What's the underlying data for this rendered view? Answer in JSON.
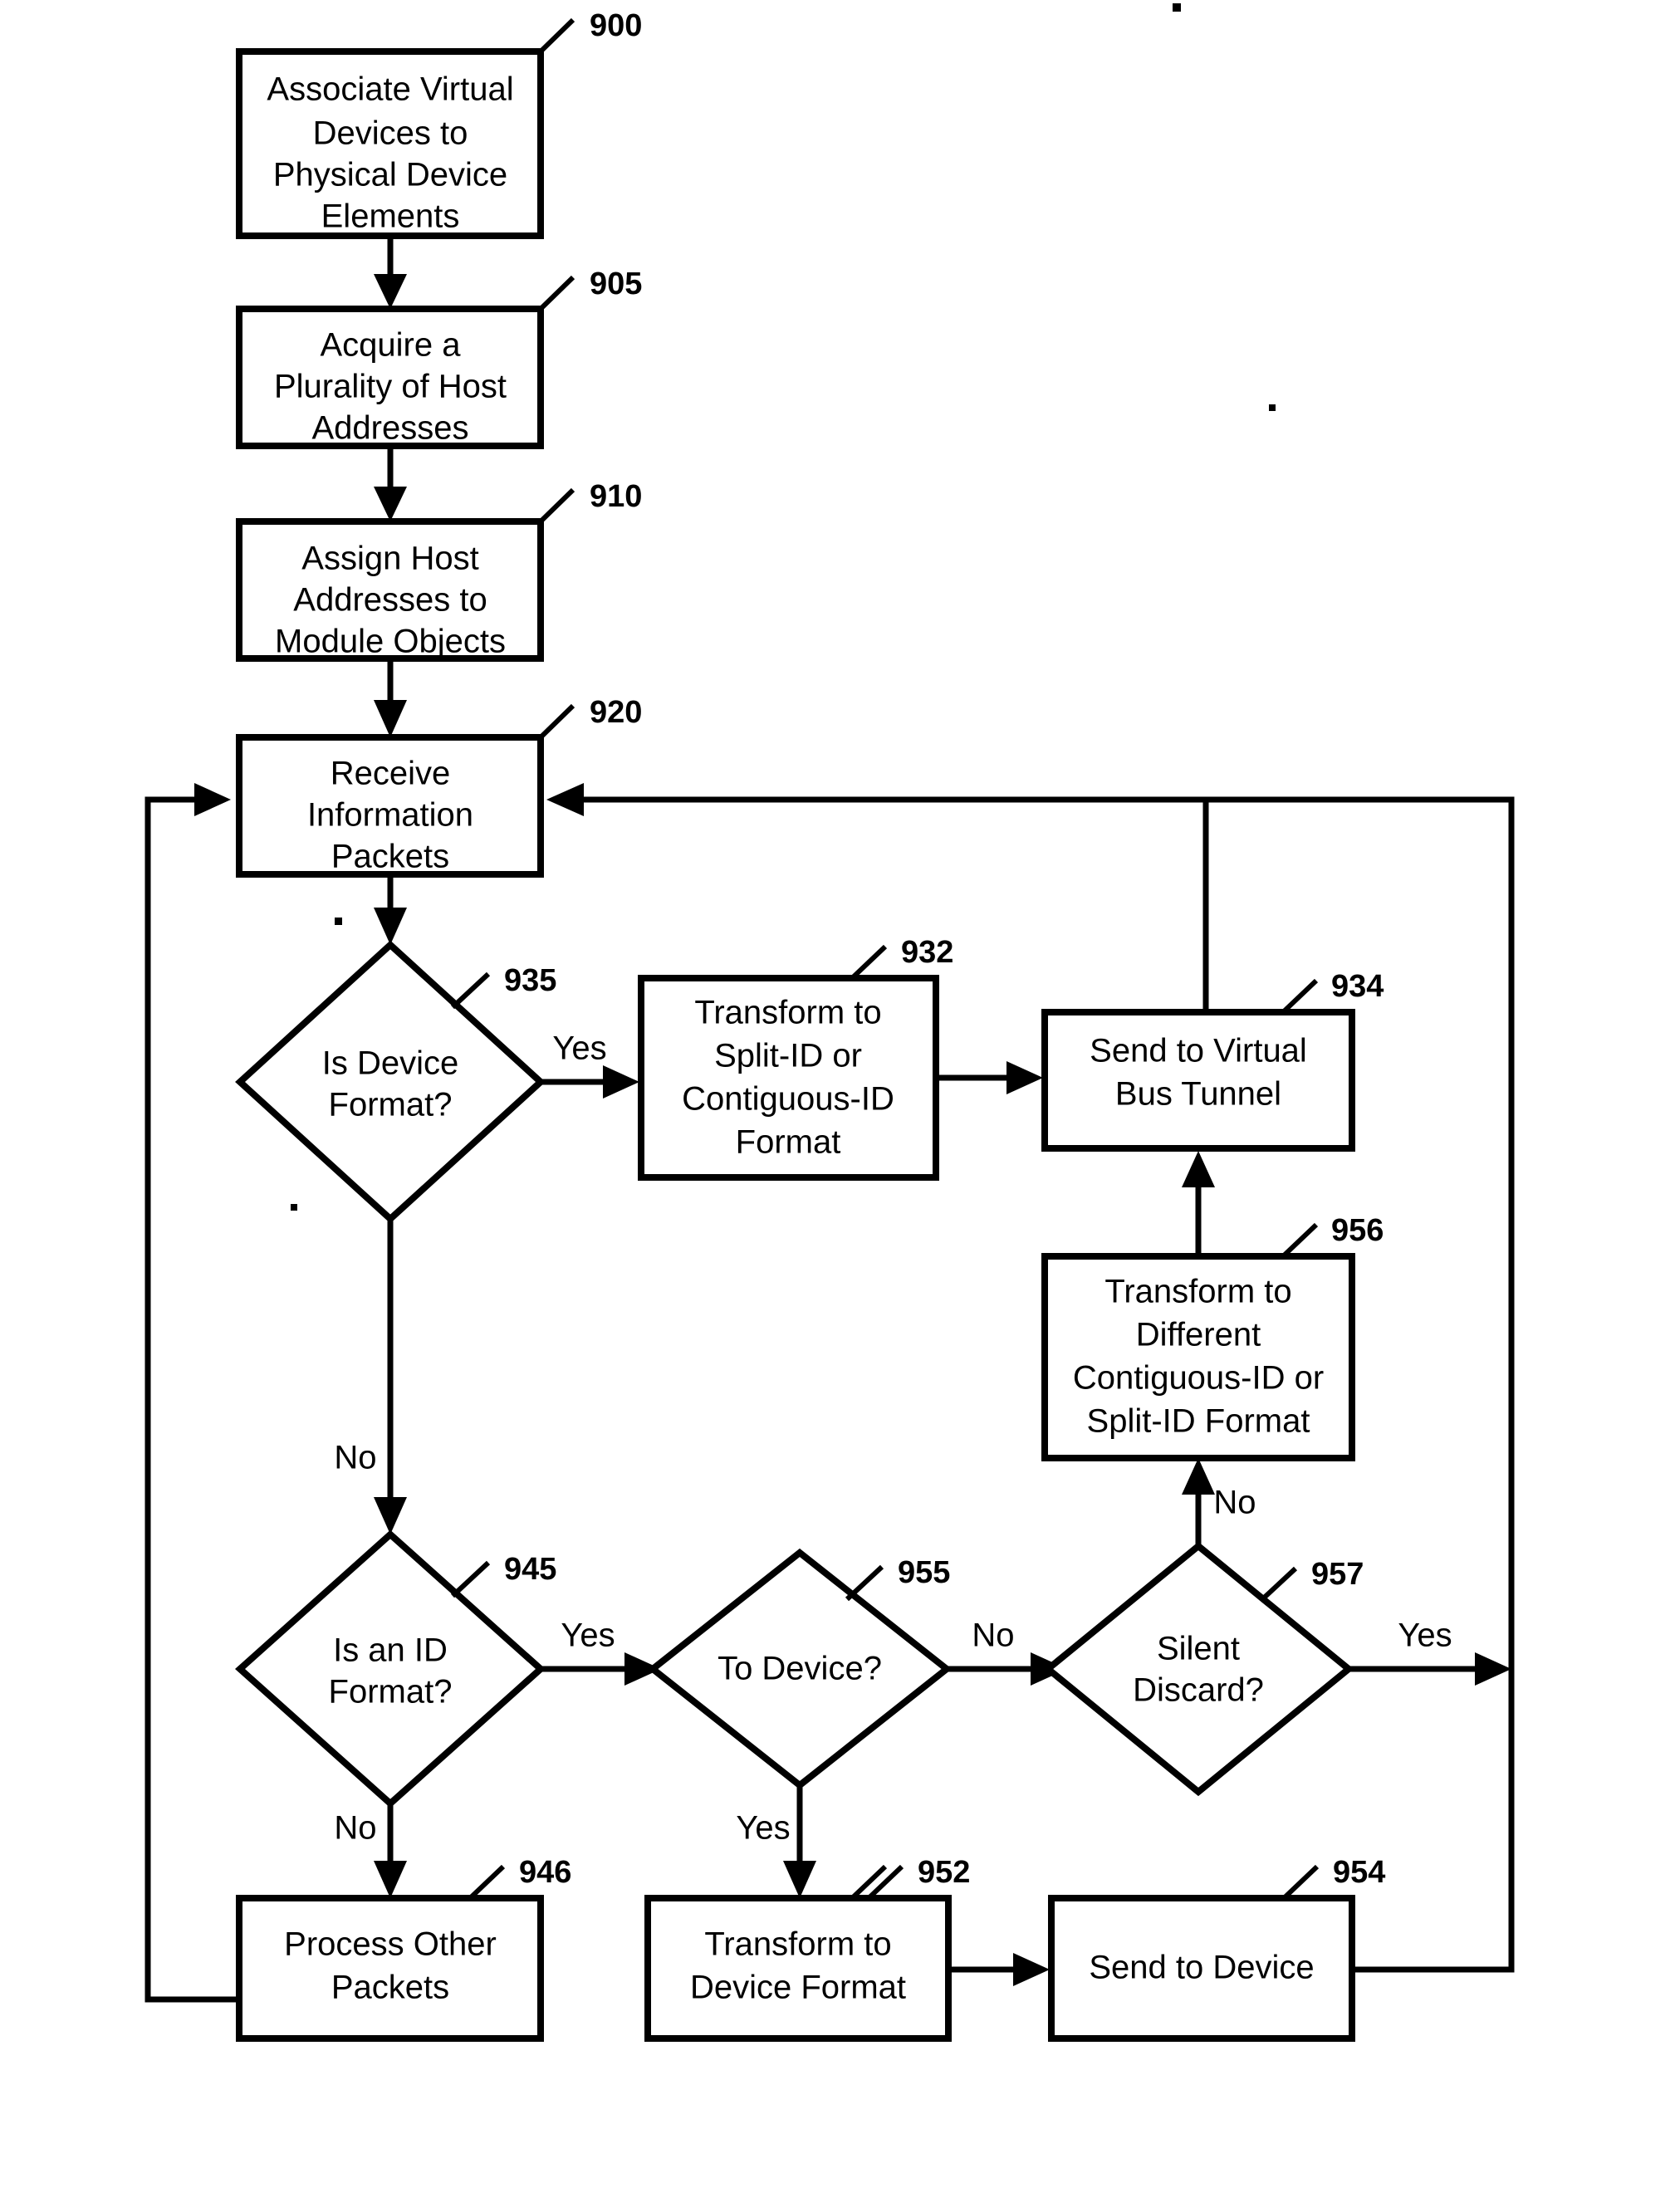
{
  "figure": {
    "type": "patent-flowchart",
    "background": "#ffffff",
    "ink": "#000000"
  },
  "nodes": [
    {
      "id": "n900",
      "ref": "900",
      "shape": "process",
      "lines": [
        "Associate Virtual",
        "Devices to",
        "Physical Device",
        "Elements"
      ]
    },
    {
      "id": "n905",
      "ref": "905",
      "shape": "process",
      "lines": [
        "Acquire a",
        "Plurality of  Host",
        "Addresses"
      ]
    },
    {
      "id": "n910",
      "ref": "910",
      "shape": "process",
      "lines": [
        "Assign Host",
        "Addresses to",
        "Module Objects"
      ]
    },
    {
      "id": "n920",
      "ref": "920",
      "shape": "process",
      "lines": [
        "Receive",
        "Information",
        "Packets"
      ]
    },
    {
      "id": "n935",
      "ref": "935",
      "shape": "decision",
      "lines": [
        "Is Device",
        "Format?"
      ]
    },
    {
      "id": "n932",
      "ref": "932",
      "shape": "process",
      "lines": [
        "Transform to",
        "Split-ID or",
        "Contiguous-ID",
        "Format"
      ]
    },
    {
      "id": "n934",
      "ref": "934",
      "shape": "process",
      "lines": [
        "Send to Virtual",
        "Bus Tunnel"
      ]
    },
    {
      "id": "n956",
      "ref": "956",
      "shape": "process",
      "lines": [
        "Transform to",
        "Different",
        "Contiguous-ID or",
        "Split-ID Format"
      ]
    },
    {
      "id": "n945",
      "ref": "945",
      "shape": "decision",
      "lines": [
        "Is an ID",
        "Format?"
      ]
    },
    {
      "id": "n955",
      "ref": "955",
      "shape": "decision",
      "lines": [
        "To Device?"
      ]
    },
    {
      "id": "n957",
      "ref": "957",
      "shape": "decision",
      "lines": [
        "Silent",
        "Discard?"
      ]
    },
    {
      "id": "n946",
      "ref": "946",
      "shape": "process",
      "lines": [
        "Process Other",
        "Packets"
      ]
    },
    {
      "id": "n952",
      "ref": "952",
      "shape": "process",
      "lines": [
        "Transform to",
        "Device Format"
      ]
    },
    {
      "id": "n954",
      "ref": "954",
      "shape": "process",
      "lines": [
        "Send to Device"
      ]
    }
  ],
  "edge_labels": {
    "d935_yes": "Yes",
    "d935_no": "No",
    "d945_yes": "Yes",
    "d945_no": "No",
    "d955_yes": "Yes",
    "d955_no": "No",
    "d957_yes": "Yes",
    "d957_no": "No"
  },
  "ref_numbers": {
    "n900": "900",
    "n905": "905",
    "n910": "910",
    "n920": "920",
    "n935": "935",
    "n932": "932",
    "n934": "934",
    "n956": "956",
    "n945": "945",
    "n955": "955",
    "n957": "957",
    "n946": "946",
    "n952": "952",
    "n954": "954"
  }
}
